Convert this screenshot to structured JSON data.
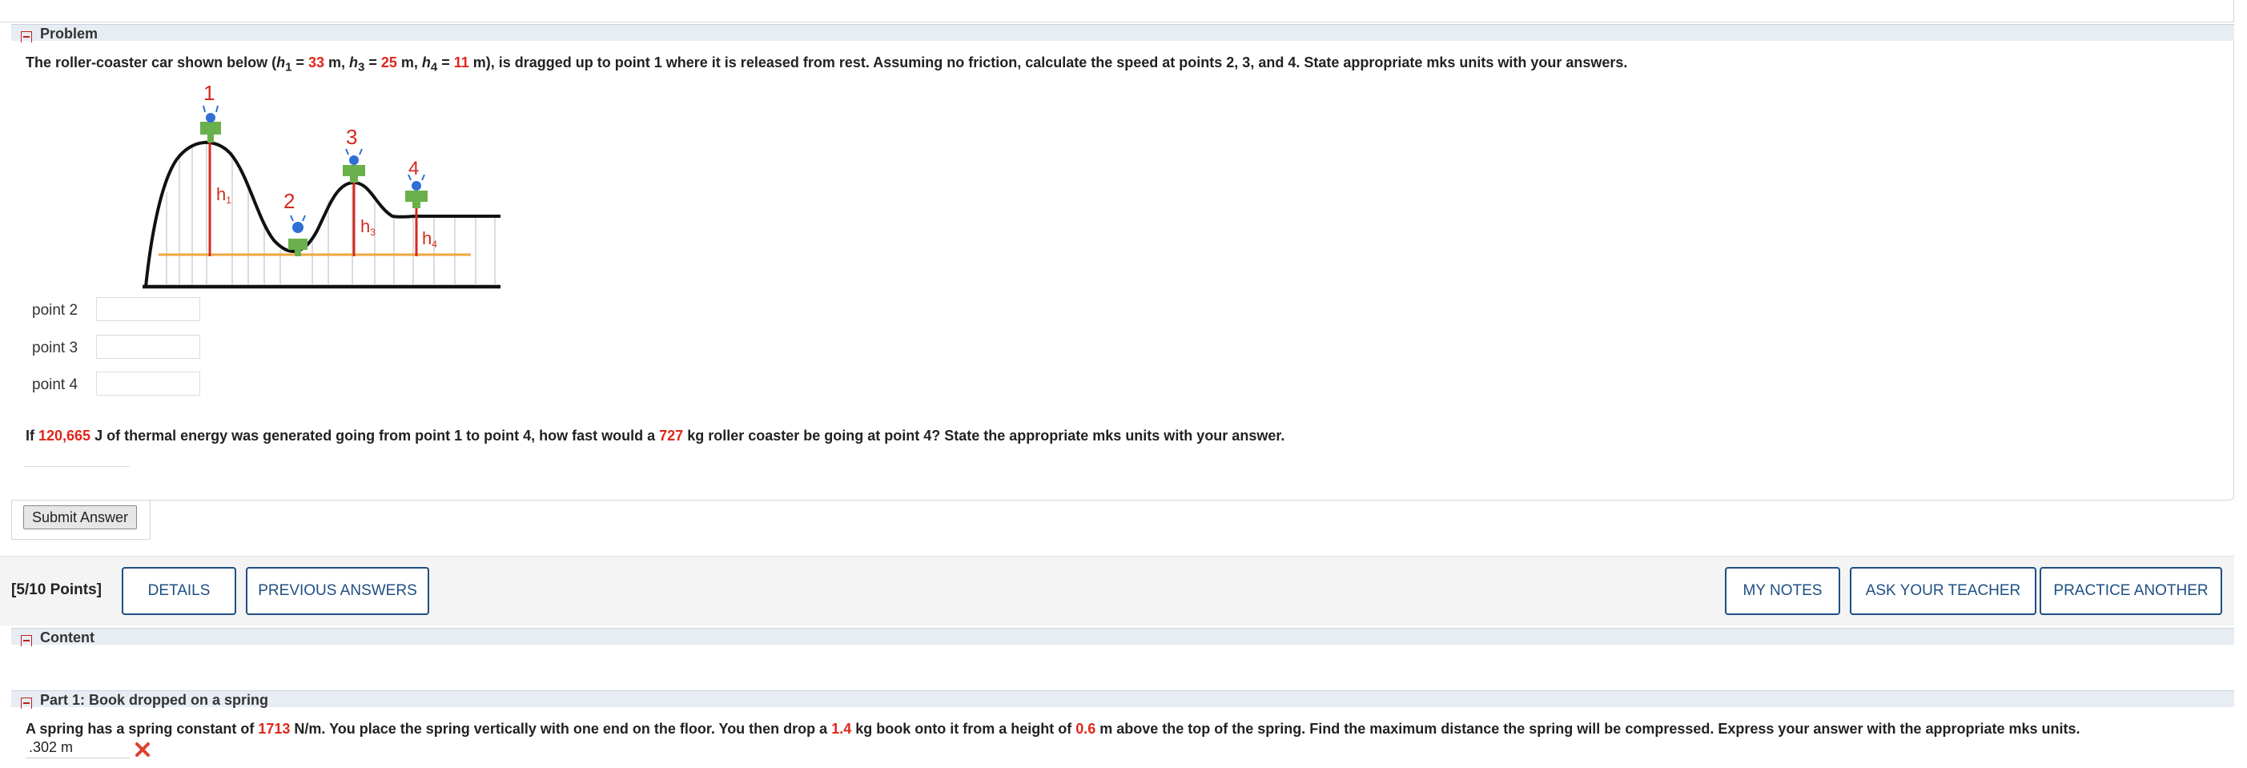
{
  "problem": {
    "header": "Problem",
    "q1": {
      "t1": "The roller-coaster car shown below (",
      "h1_var": "h",
      "h1_sub": "1",
      "eq": " = ",
      "h1_val": "33",
      "unit1": " m, ",
      "h3_var": "h",
      "h3_sub": "3",
      "h3_val": "25",
      "h4_var": "h",
      "h4_sub": "4",
      "h4_val": "11",
      "t2": " m), is dragged up to point 1 where it is released from rest. Assuming no friction, calculate the speed at points 2, 3, and 4. State appropriate mks units with your answers."
    },
    "figure": {
      "pt1": "1",
      "pt2": "2",
      "pt3": "3",
      "pt4": "4",
      "h1": "h",
      "h1s": "1",
      "h3": "h",
      "h3s": "3",
      "h4": "h",
      "h4s": "4"
    },
    "answers": [
      {
        "label": "point 2",
        "value": ""
      },
      {
        "label": "point 3",
        "value": ""
      },
      {
        "label": "point 4",
        "value": ""
      }
    ],
    "q2": {
      "t1": "If ",
      "energy": "120,665",
      "t2": " J of thermal energy was generated going from point 1 to point 4, how fast would a ",
      "mass": "727",
      "t3": " kg roller coaster be going at point 4? State the appropriate mks units with your answer."
    },
    "submit": "Submit Answer"
  },
  "next_question": {
    "points": "[5/10 Points]",
    "details": "DETAILS",
    "previous_answers": "PREVIOUS ANSWERS",
    "my_notes": "MY NOTES",
    "ask_teacher": "ASK YOUR TEACHER",
    "practice_another": "PRACTICE ANOTHER",
    "content_header": "Content",
    "part1_header": "Part 1: Book dropped on a spring",
    "part1": {
      "t1": "A spring has a spring constant of ",
      "k": "1713",
      "t2": " N/m. You place the spring vertically with one end on the floor. You then drop a ",
      "m": "1.4",
      "t3": " kg book onto it from a height of ",
      "h": "0.6",
      "t4": " m above the top of the spring. Find the maximum distance the spring will be compressed. Express your answer with the appropriate mks units."
    },
    "answer_value": ".302 m",
    "status": "incorrect"
  },
  "colors": {
    "accent": "#1f4f83",
    "given": "#e0261b",
    "car_green": "#6ab04c",
    "rider_blue": "#2f6fd6",
    "ground_orange": "#f0a640"
  }
}
